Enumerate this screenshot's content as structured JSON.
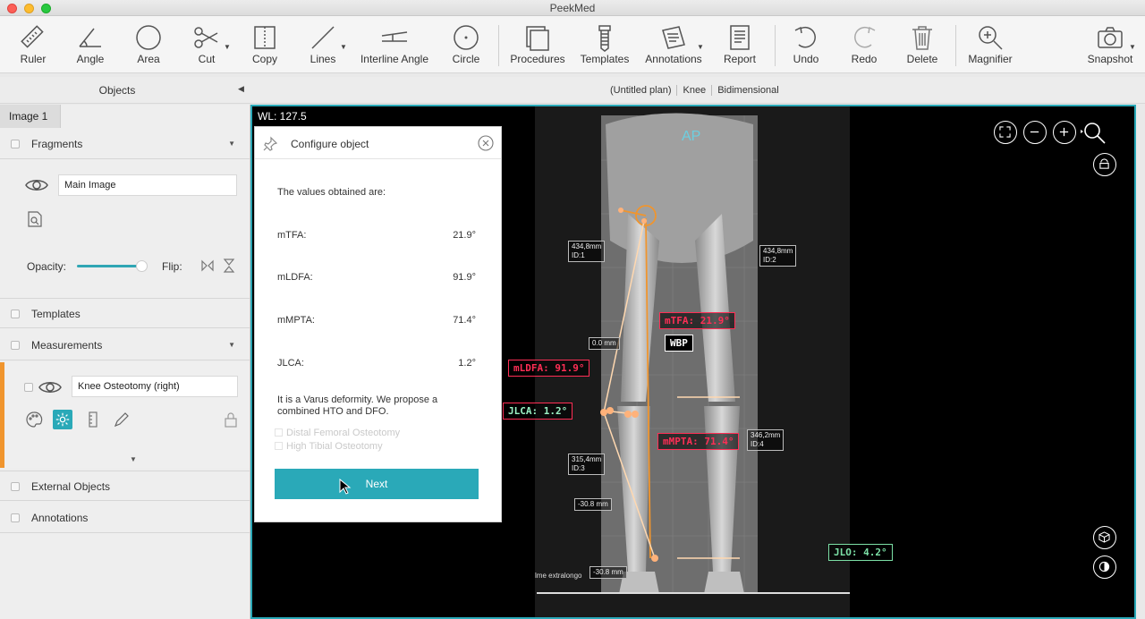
{
  "window": {
    "title": "PeekMed"
  },
  "toolbar": {
    "ruler": "Ruler",
    "angle": "Angle",
    "area": "Area",
    "cut": "Cut",
    "copy": "Copy",
    "lines": "Lines",
    "interline_angle": "Interline Angle",
    "circle": "Circle",
    "procedures": "Procedures",
    "templates": "Templates",
    "annotations": "Annotations",
    "report": "Report",
    "undo": "Undo",
    "redo": "Redo",
    "delete": "Delete",
    "magnifier": "Magnifier",
    "snapshot": "Snapshot"
  },
  "objects_panel": {
    "title": "Objects"
  },
  "breadcrumb": [
    "(Untitled plan)",
    "Knee",
    "Bidimensional"
  ],
  "sidebar": {
    "image_tab": "Image 1",
    "fragments": "Fragments",
    "main_image": "Main Image",
    "opacity_label": "Opacity:",
    "flip_label": "Flip:",
    "templates": "Templates",
    "measurements": "Measurements",
    "measurement_item": "Knee Osteotomy (right)",
    "external_objects": "External Objects",
    "annotations": "Annotations"
  },
  "viewer": {
    "wl": "WL: 127.5",
    "view_label": "AP",
    "tags": {
      "mtfa": "mTFA: 21.9°",
      "wbp": "WBP",
      "mldfa": "mLDFA: 91.9°",
      "jlca": "JLCA: 1.2°",
      "mmpta": "mMPTA: 71.4°",
      "jlo": "JLO: 4.2°"
    },
    "dims": {
      "d1a": "434,8mm",
      "d1b": "ID:1",
      "d2a": "434,8mm",
      "d2b": "ID:2",
      "d3a": "315,4mm",
      "d3b": "ID:3",
      "d4a": "346,2mm",
      "d4b": "ID:4",
      "zero": "0.0 mm",
      "neg1": "-30.8 mm",
      "neg2": "-30.8 mm",
      "lime": "lme extralongo"
    }
  },
  "dialog": {
    "title": "Configure object",
    "intro": "The values obtained are:",
    "rows": [
      {
        "label": "mTFA:",
        "value": "21.9°"
      },
      {
        "label": "mLDFA:",
        "value": "91.9°"
      },
      {
        "label": "mMPTA:",
        "value": "71.4°"
      },
      {
        "label": "JLCA:",
        "value": "1.2°"
      }
    ],
    "message_line1": "It is a Varus deformity. We propose a",
    "message_line2": "combined HTO and DFO.",
    "option1": "Distal Femoral Osteotomy",
    "option2": "High Tibial Osteotomy",
    "next": "Next"
  },
  "colors": {
    "accent": "#2aa9b8",
    "highlight": "#f0952e",
    "red_tag": "#ff2e55",
    "green_tag": "#7ce0a6"
  }
}
